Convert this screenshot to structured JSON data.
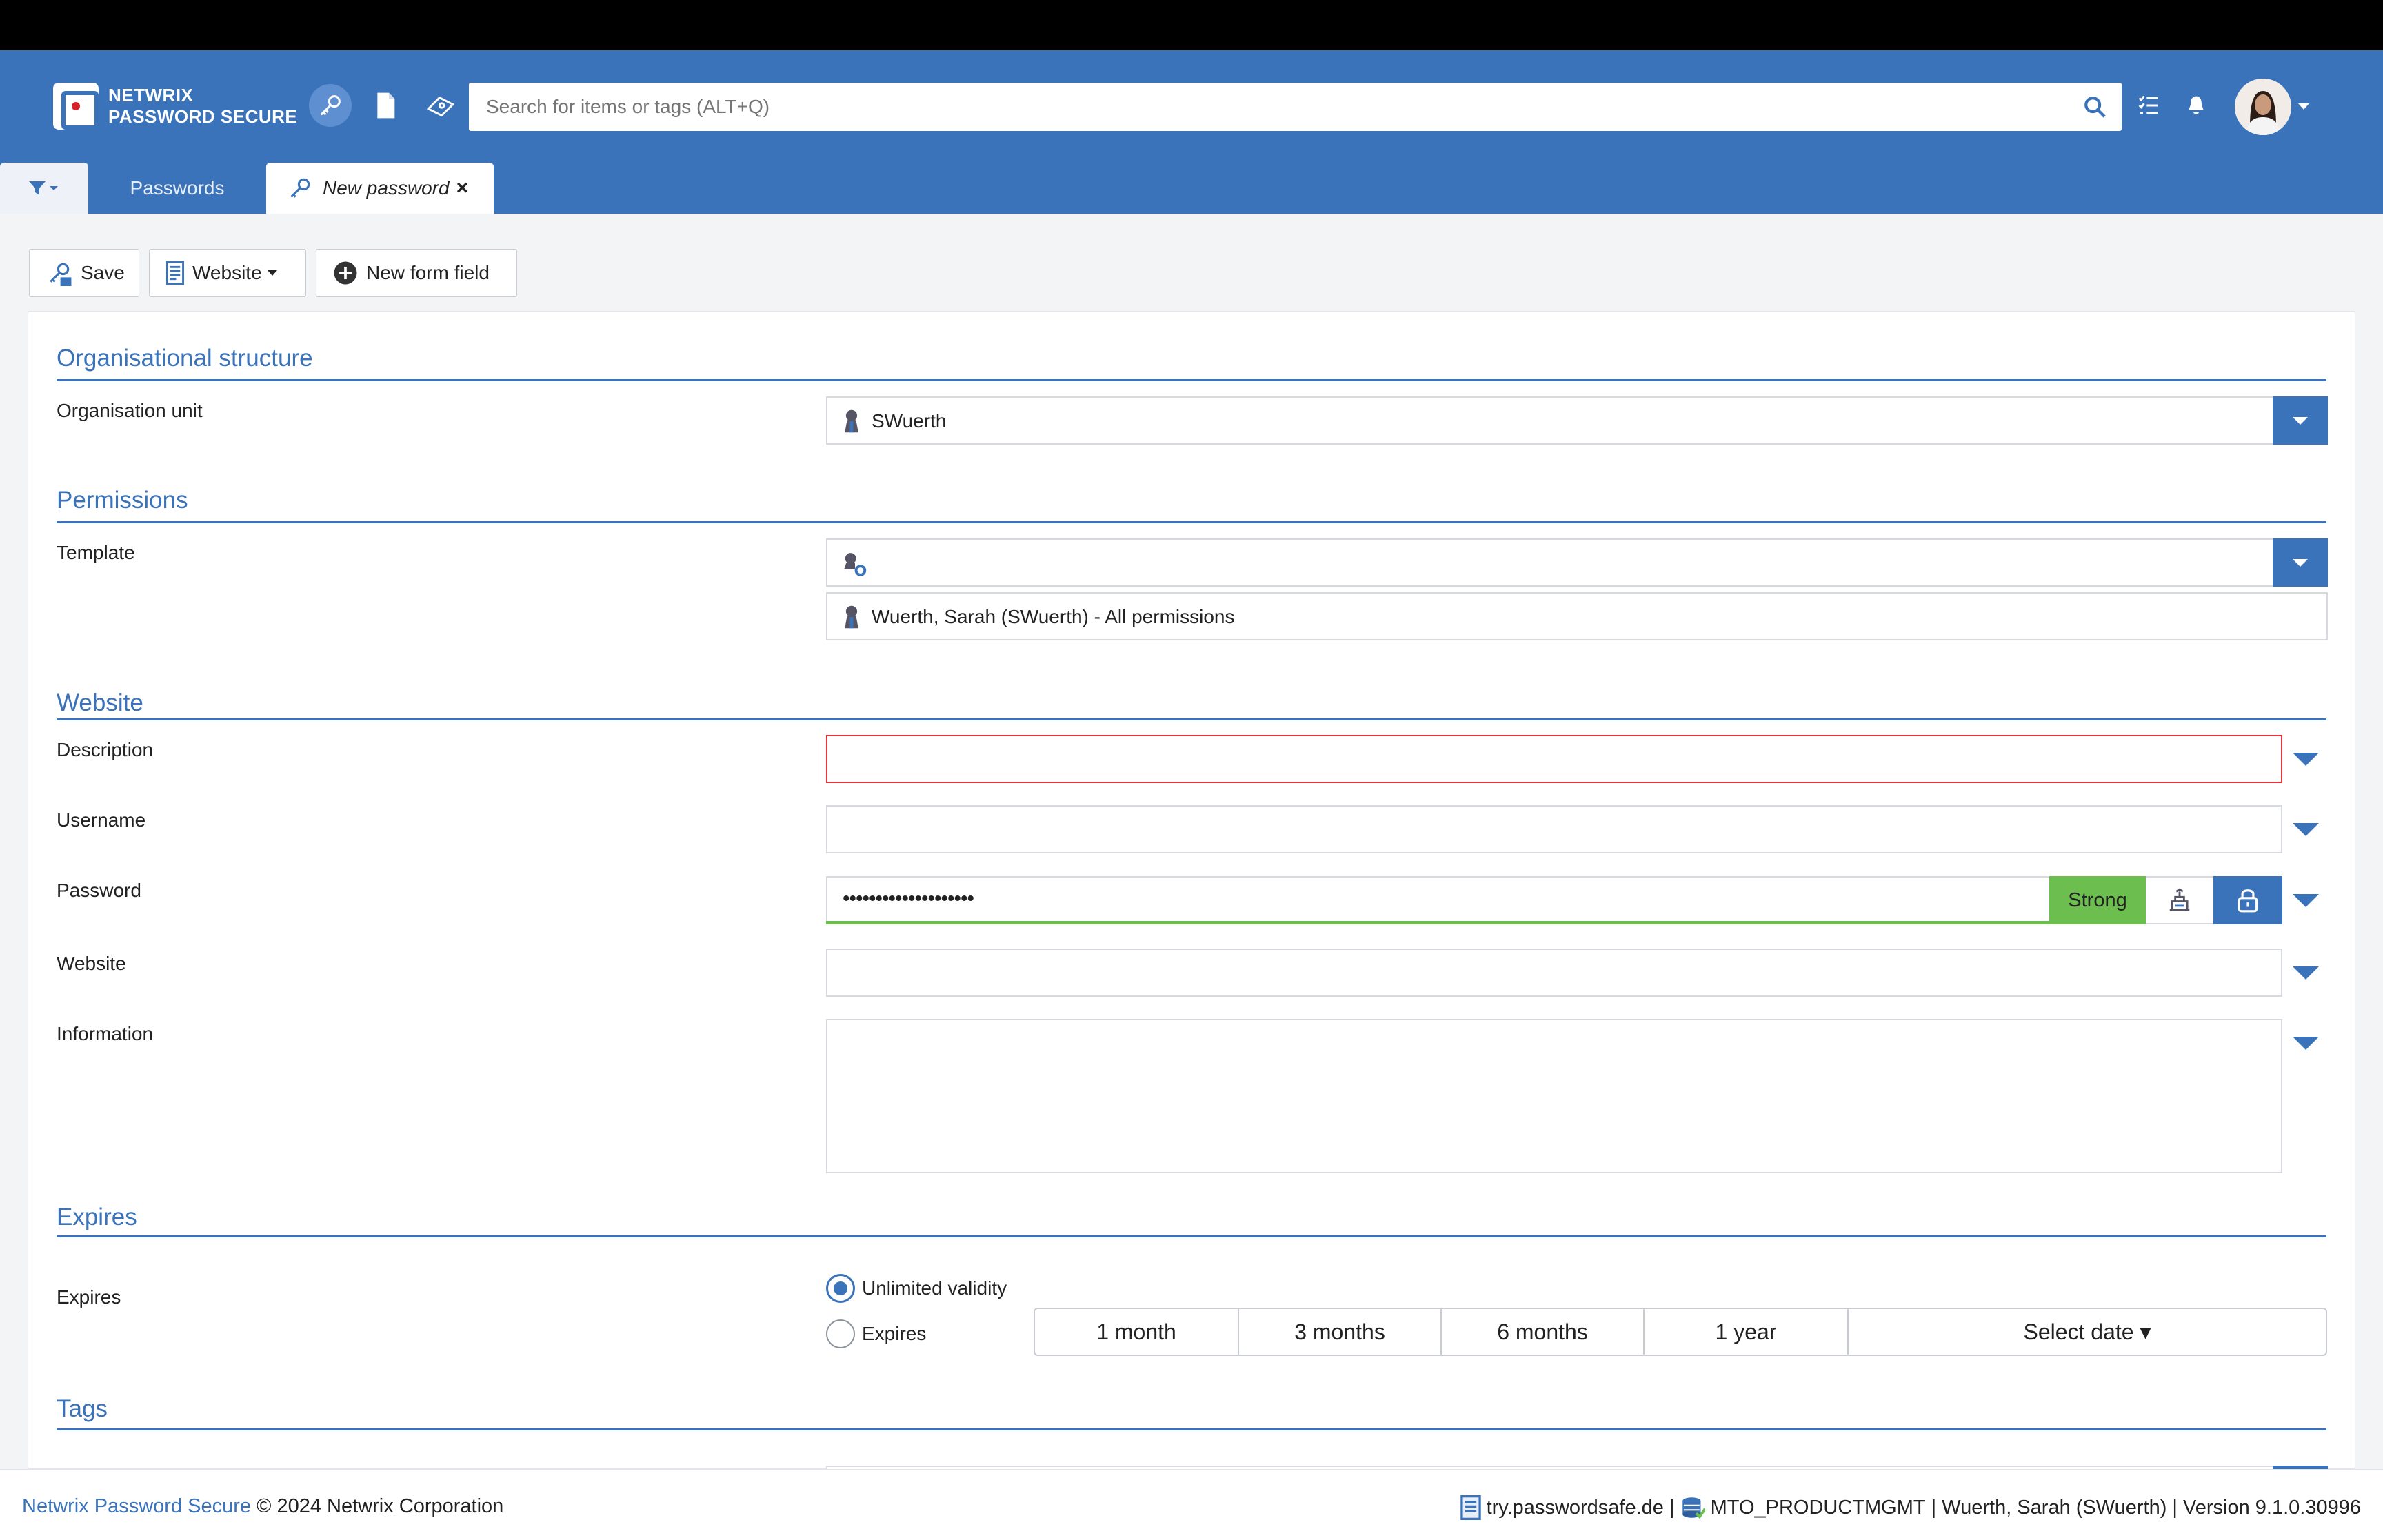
{
  "app": {
    "logo_line1": "NETWRIX",
    "logo_line2": "PASSWORD SECURE"
  },
  "search": {
    "placeholder": "Search for items or tags (ALT+Q)"
  },
  "tabs": {
    "passwords": "Passwords",
    "new_password": "New password",
    "close": "×"
  },
  "toolbar": {
    "save": "Save",
    "website": "Website",
    "new_form_field": "New form field"
  },
  "sections": {
    "org": "Organisational structure",
    "permissions": "Permissions",
    "website": "Website",
    "expires": "Expires",
    "tags": "Tags"
  },
  "fields": {
    "org_unit_label": "Organisation unit",
    "org_unit_value": "SWuerth",
    "template_label": "Template",
    "permission_entry": "Wuerth, Sarah (SWuerth) - All permissions",
    "description_label": "Description",
    "username_label": "Username",
    "password_label": "Password",
    "password_value": "••••••••••••••••••••",
    "password_strength": "Strong",
    "website_label": "Website",
    "information_label": "Information",
    "expires_label": "Expires"
  },
  "expiry": {
    "unlimited": "Unlimited validity",
    "expires": "Expires",
    "options": [
      "1 month",
      "3 months",
      "6 months",
      "1 year",
      "Select date ▾"
    ]
  },
  "footer": {
    "brand": "Netwrix Password Secure",
    "copyright": " © 2024 Netwrix Corporation",
    "server": "try.passwordsafe.de",
    "sep1": " | ",
    "database": "MTO_PRODUCTMGMT",
    "user_version": " | Wuerth, Sarah (SWuerth) | Version 9.1.0.30996"
  },
  "colors": {
    "brand_blue": "#3a73ba",
    "strong_green": "#6cbf4e",
    "error_red": "#e5343c"
  }
}
